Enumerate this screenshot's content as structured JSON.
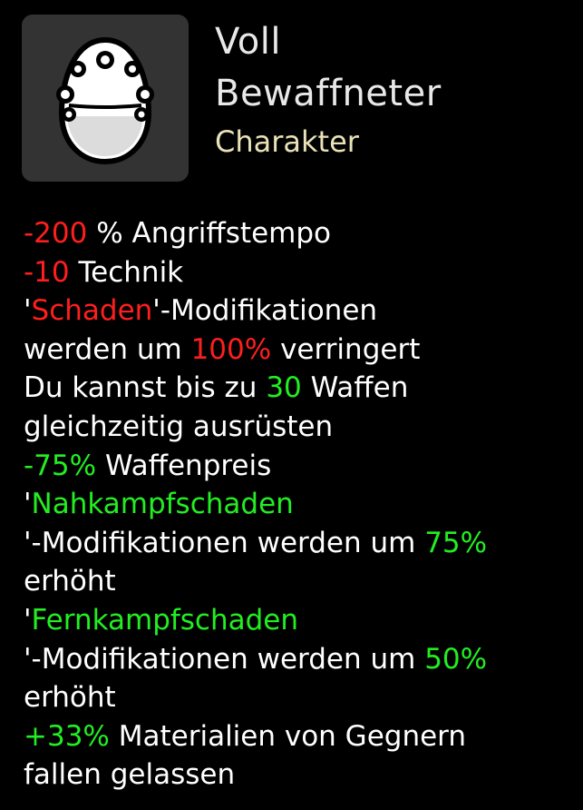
{
  "item": {
    "title_line1": "Voll",
    "title_line2": "Bewaffneter",
    "category": "Charakter",
    "icon": "egg-character-icon"
  },
  "colors": {
    "background": "#000000",
    "icon_box": "#333333",
    "title": "#e8e8e8",
    "category": "#eae2b7",
    "negative": "#ff1e1e",
    "positive": "#22ee22",
    "text": "#ffffff"
  },
  "effects": {
    "attack_speed": {
      "value": "-200",
      "text": " % Angriffstempo"
    },
    "engineering": {
      "value": "-10",
      "text": " Technik"
    },
    "damage_mods": {
      "quote_open": "'",
      "keyword": "Schaden",
      "text_a": "'-Modifikationen",
      "text_b": "werden um ",
      "value": "100%",
      "text_c": " verringert"
    },
    "weapons": {
      "text_a": "Du kannst bis zu ",
      "value": "30",
      "text_b": " Waffen",
      "text_c": "gleichzeitig ausrüsten"
    },
    "weapon_price": {
      "value": "-75%",
      "text": " Waffenpreis"
    },
    "melee_mods": {
      "quote_open": "'",
      "keyword": "Nahkampfschaden",
      "text_a": "'-Modifikationen werden um ",
      "value": "75%",
      "text_b": "erhöht"
    },
    "ranged_mods": {
      "quote_open": "'",
      "keyword": "Fernkampfschaden",
      "text_a": "'-Modifikationen werden um ",
      "value": "50%",
      "text_b": "erhöht"
    },
    "materials": {
      "value": "+33%",
      "text_a": " Materialien von Gegnern",
      "text_b": "fallen gelassen"
    }
  }
}
